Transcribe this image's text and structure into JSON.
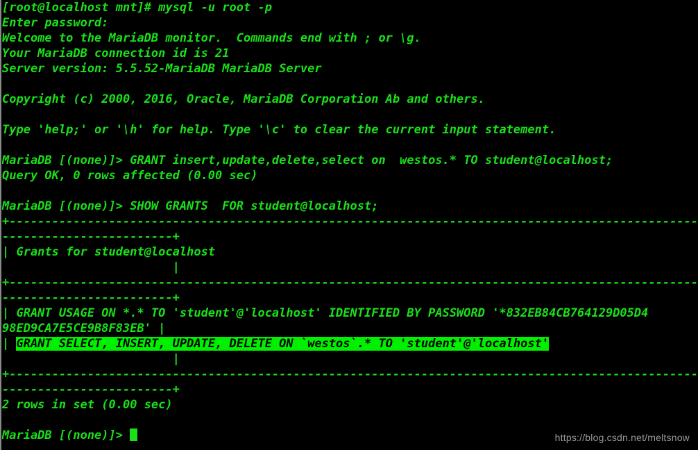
{
  "terminal": {
    "title": "root@localhost:/mnt — mysql client",
    "foreground_color": "#19e019",
    "background_color": "#000000",
    "highlight_background_color": "#00f000",
    "highlight_foreground_color": "#000000",
    "watermark_color": "#9a9a9a",
    "scrollbar_color": "#8a8a8a",
    "columns": 102,
    "rows": 29
  },
  "watermark": {
    "text": "https://blog.csdn.net/meltsnow"
  },
  "session": {
    "shell_prompt": "[root@localhost mnt]#",
    "command": "mysql -u root -p",
    "password_prompt": "Enter password:",
    "welcome": "Welcome to the MariaDB monitor.  Commands end with ; or \\g.",
    "connection_id_line": "Your MariaDB connection id is 21",
    "server_version_line": "Server version: 5.5.52-MariaDB MariaDB Server",
    "copyright": "Copyright (c) 2000, 2016, Oracle, MariaDB Corporation Ab and others.",
    "help_hint": "Type 'help;' or '\\h' for help. Type '\\c' to clear the current input statement.",
    "mysql_prompt": "MariaDB [(none)]>",
    "grant_statement": " GRANT insert,update,delete,select on  westos.* TO student@localhost;",
    "grant_result": "Query OK, 0 rows affected (0.00 sec)",
    "show_grants_statement": " SHOW GRANTS  FOR student@localhost;",
    "row_count": "2 rows in set (0.00 sec)"
  },
  "grants_table": {
    "header": "| Grants for student@localhost",
    "header_continuation": "                        |",
    "separator_part1": "+-----------------------------------------------------------------------------------------------------",
    "separator_part2": "------------------------+",
    "row1_part1": "| GRANT USAGE ON *.* TO 'student'@'localhost' IDENTIFIED BY PASSWORD '*832EB84CB764129D05D4",
    "row1_part2": "98ED9CA7E5CE9B8F83EB' |",
    "row2_prefix": "| ",
    "row2_highlighted": "GRANT SELECT, INSERT, UPDATE, DELETE ON `westos`.* TO 'student'@'localhost'",
    "row2_continuation": "                        |"
  },
  "lines": [
    {
      "id": "shell-command",
      "type": "text",
      "content": "[root@localhost mnt]# mysql -u root -p"
    },
    {
      "id": "password-prompt",
      "type": "text",
      "content": "Enter password:"
    },
    {
      "id": "welcome-banner",
      "type": "text",
      "content": "Welcome to the MariaDB monitor.  Commands end with ; or \\g."
    },
    {
      "id": "connection-id",
      "type": "text",
      "content": "Your MariaDB connection id is 21"
    },
    {
      "id": "server-version",
      "type": "text",
      "content": "Server version: 5.5.52-MariaDB MariaDB Server"
    },
    {
      "id": "blank-1",
      "type": "blank",
      "content": ""
    },
    {
      "id": "copyright-notice",
      "type": "text",
      "content": "Copyright (c) 2000, 2016, Oracle, MariaDB Corporation Ab and others."
    },
    {
      "id": "blank-2",
      "type": "blank",
      "content": ""
    },
    {
      "id": "help-hint",
      "type": "text",
      "content": "Type 'help;' or '\\h' for help. Type '\\c' to clear the current input statement."
    },
    {
      "id": "blank-3",
      "type": "blank",
      "content": ""
    },
    {
      "id": "grant-command",
      "type": "text",
      "content": "MariaDB [(none)]> GRANT insert,update,delete,select on  westos.* TO student@localhost;"
    },
    {
      "id": "grant-result",
      "type": "text",
      "content": "Query OK, 0 rows affected (0.00 sec)"
    },
    {
      "id": "blank-4",
      "type": "blank",
      "content": ""
    },
    {
      "id": "show-grants-command",
      "type": "text",
      "content": "MariaDB [(none)]> SHOW GRANTS  FOR student@localhost;"
    },
    {
      "id": "table-top-border-a",
      "type": "text",
      "content": "+-----------------------------------------------------------------------------------------------------"
    },
    {
      "id": "table-top-border-b",
      "type": "text",
      "content": "------------------------+"
    },
    {
      "id": "table-header",
      "type": "text",
      "content": "| Grants for student@localhost"
    },
    {
      "id": "table-header-cont",
      "type": "text",
      "content": "                        |"
    },
    {
      "id": "table-mid-border-a",
      "type": "text",
      "content": "+-----------------------------------------------------------------------------------------------------"
    },
    {
      "id": "table-mid-border-b",
      "type": "text",
      "content": "------------------------+"
    },
    {
      "id": "grant-row-1a",
      "type": "text",
      "content": "| GRANT USAGE ON *.* TO 'student'@'localhost' IDENTIFIED BY PASSWORD '*832EB84CB764129D05D4"
    },
    {
      "id": "grant-row-1b",
      "type": "text",
      "content": "98ED9CA7E5CE9B8F83EB' |"
    },
    {
      "id": "grant-row-2",
      "type": "highlight",
      "prefix": "| ",
      "content": "GRANT SELECT, INSERT, UPDATE, DELETE ON `westos`.* TO 'student'@'localhost'"
    },
    {
      "id": "grant-row-2-cont",
      "type": "text",
      "content": "                        |"
    },
    {
      "id": "table-bot-border-a",
      "type": "text",
      "content": "+-----------------------------------------------------------------------------------------------------"
    },
    {
      "id": "table-bot-border-b",
      "type": "text",
      "content": "------------------------+"
    },
    {
      "id": "row-count",
      "type": "text",
      "content": "2 rows in set (0.00 sec)"
    },
    {
      "id": "blank-5",
      "type": "blank",
      "content": ""
    },
    {
      "id": "final-prompt",
      "type": "cursor",
      "content": "MariaDB [(none)]> "
    }
  ]
}
